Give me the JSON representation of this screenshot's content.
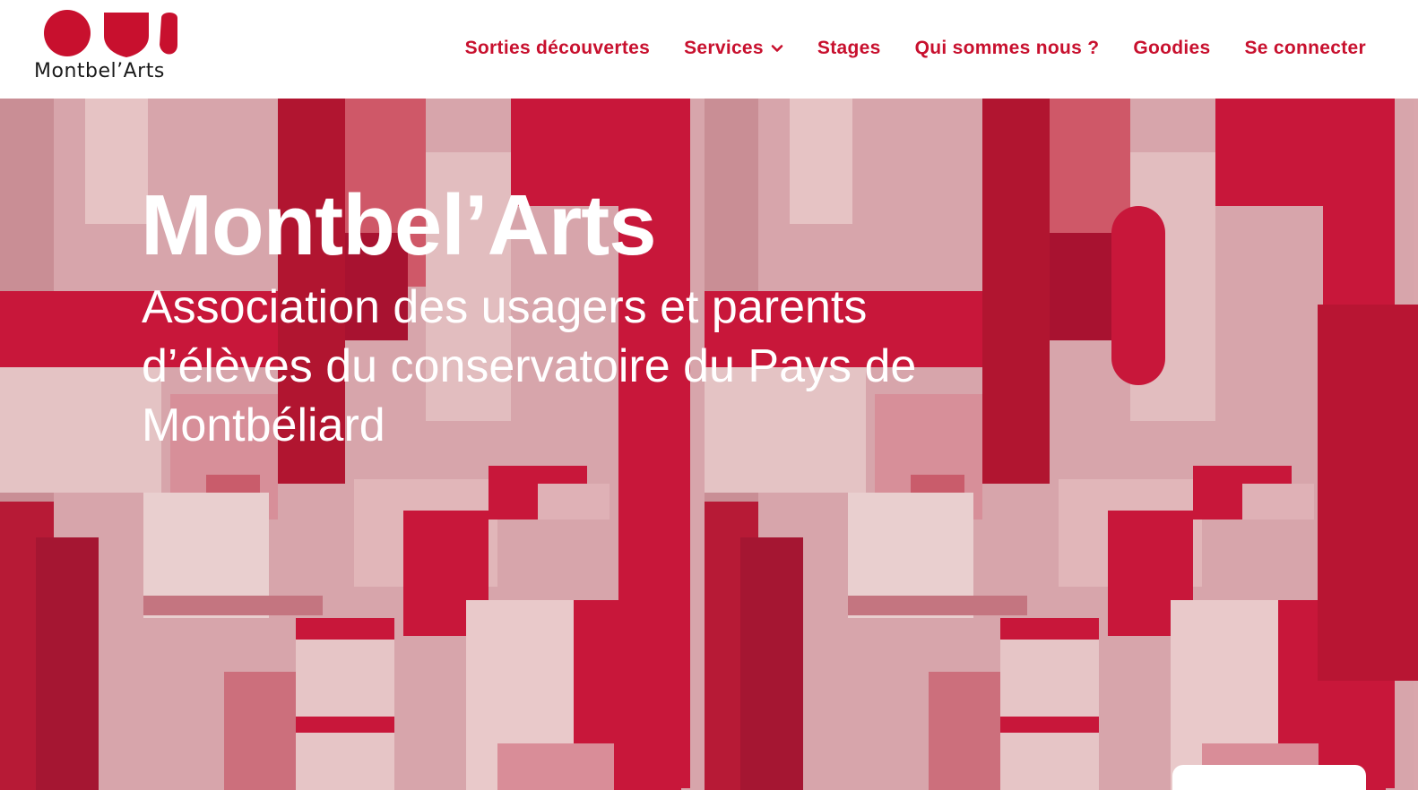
{
  "brand": {
    "name": "Montbel’Arts",
    "accent_color": "#c8102e"
  },
  "nav": {
    "items": [
      {
        "label": "Sorties découvertes"
      },
      {
        "label": "Services",
        "icon": "chevron-down-icon"
      },
      {
        "label": "Stages"
      },
      {
        "label": "Qui sommes nous ?"
      },
      {
        "label": "Goodies"
      },
      {
        "label": "Se connecter"
      }
    ]
  },
  "hero": {
    "title": "Montbel’Arts",
    "subtitle": "Association des usagers et parents d’élèves du conservatoire du Pays de Montbéliard"
  }
}
